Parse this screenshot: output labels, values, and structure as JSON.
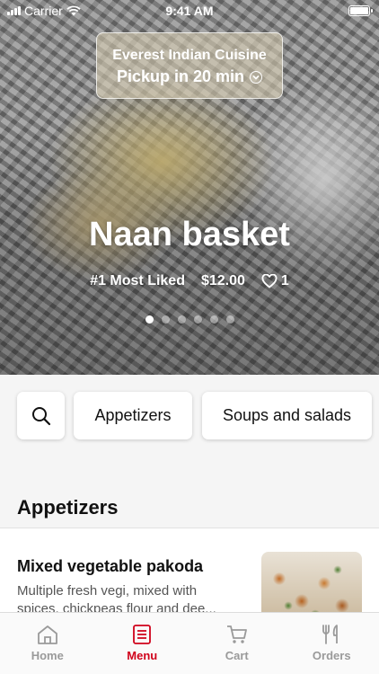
{
  "status_bar": {
    "carrier": "Carrier",
    "time": "9:41 AM"
  },
  "store": {
    "name": "Everest Indian Cuisine",
    "pickup": "Pickup in 20 min"
  },
  "featured": {
    "title": "Naan basket",
    "rank": "#1 Most Liked",
    "price": "$12.00",
    "likes": "1",
    "carousel_count": 6,
    "carousel_active": 1
  },
  "categories": [
    "Appetizers",
    "Soups and salads"
  ],
  "section": {
    "title": "Appetizers"
  },
  "item": {
    "name": "Mixed vegetable pakoda",
    "description": "Multiple fresh vegi, mixed with spices, chickpeas flour and dee..."
  },
  "tabs": [
    {
      "label": "Home",
      "icon": "home-icon"
    },
    {
      "label": "Menu",
      "icon": "menu-icon"
    },
    {
      "label": "Cart",
      "icon": "cart-icon"
    },
    {
      "label": "Orders",
      "icon": "orders-icon"
    }
  ],
  "colors": {
    "accent": "#d0021b",
    "inactive_tab": "#9a9a9a"
  }
}
